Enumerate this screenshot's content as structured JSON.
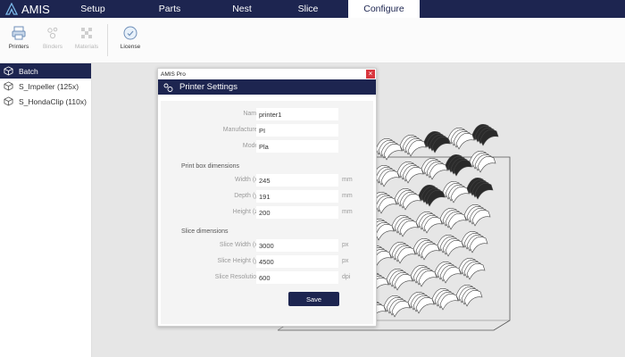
{
  "app": {
    "name": "AMIS"
  },
  "nav": {
    "tabs": [
      {
        "label": "Setup"
      },
      {
        "label": "Parts"
      },
      {
        "label": "Nest"
      },
      {
        "label": "Slice"
      },
      {
        "label": "Configure"
      }
    ],
    "active": "Configure"
  },
  "toolbar": {
    "items": [
      {
        "label": "Printers",
        "icon": "printer-icon",
        "enabled": true
      },
      {
        "label": "Binders",
        "icon": "binder-icon",
        "enabled": false
      },
      {
        "label": "Materials",
        "icon": "materials-icon",
        "enabled": false
      },
      {
        "label": "License",
        "icon": "license-icon",
        "enabled": true
      }
    ]
  },
  "sidebar": {
    "items": [
      {
        "label": "Batch",
        "icon": "cube-icon",
        "active": true
      },
      {
        "label": "S_Impeller (125x)",
        "icon": "cube-icon",
        "active": false
      },
      {
        "label": "S_HondaClip (110x)",
        "icon": "cube-icon",
        "active": false
      }
    ]
  },
  "dialog": {
    "window_title": "AMIS Pro",
    "close_glyph": "×",
    "header": "Printer Settings",
    "fields": {
      "name": {
        "label": "Name",
        "value": "printer1"
      },
      "manufacturer": {
        "label": "Manufacturer",
        "value": "PI"
      },
      "model": {
        "label": "Model",
        "value": "Pla"
      }
    },
    "print_box": {
      "title": "Print box dimensions",
      "width": {
        "label": "Width (x)",
        "value": "245",
        "unit": "mm"
      },
      "depth": {
        "label": "Depth (y)",
        "value": "191",
        "unit": "mm"
      },
      "height": {
        "label": "Height (z)",
        "value": "200",
        "unit": "mm"
      }
    },
    "slice": {
      "title": "Slice dimensions",
      "width": {
        "label": "Slice Width (x)",
        "value": "3000",
        "unit": "px"
      },
      "height": {
        "label": "Slice Height (y)",
        "value": "4500",
        "unit": "px"
      },
      "resolution": {
        "label": "Slice Resolution",
        "value": "600",
        "unit": "dpi"
      }
    },
    "save_label": "Save"
  },
  "colors": {
    "brand_navy": "#1d2550",
    "close_red": "#d9363e"
  }
}
